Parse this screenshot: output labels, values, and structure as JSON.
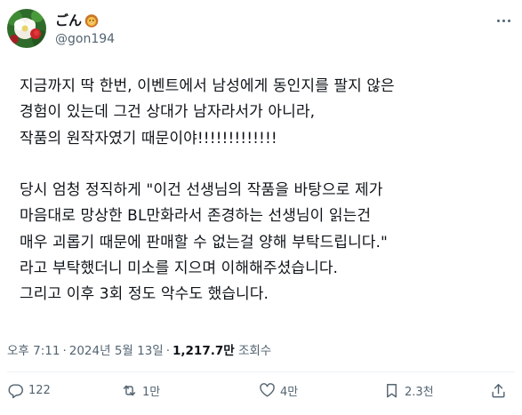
{
  "author": {
    "display_name": "ごん",
    "handle": "@gon194",
    "avatar_icon": "avatar-flower-photo",
    "name_emoji_icon": "lion-face-icon"
  },
  "tweet": {
    "lines": [
      "지금까지 딱 한번, 이벤트에서 남성에게 동인지를 팔지 않은",
      "경험이 있는데 그건 상대가 남자라서가 아니라,",
      "작품의 원작자였기 때문이야!!!!!!!!!!!!!",
      "",
      "당시 엄청 정직하게 \"이건 선생님의 작품을 바탕으로 제가",
      "마음대로 망상한 BL만화라서 존경하는 선생님이 읽는건",
      "매우 괴롭기 때문에 판매할 수 없는걸 양해 부탁드립니다.\"",
      "라고 부탁했더니 미소를 지으며 이해해주셨습니다.",
      "그리고 이후 3회 정도 악수도 했습니다."
    ]
  },
  "meta": {
    "time": "오후 7:11",
    "dot1": "·",
    "date": "2024년 5월 13일",
    "dot2": "·",
    "views_count": "1,217.7만",
    "views_label": "조회수"
  },
  "actions": {
    "replies": "122",
    "reposts": "1만",
    "likes": "4만",
    "bookmarks": "2.3천"
  },
  "colors": {
    "text": "#0f1419",
    "secondary": "#536471",
    "divider": "#eff3f4"
  }
}
